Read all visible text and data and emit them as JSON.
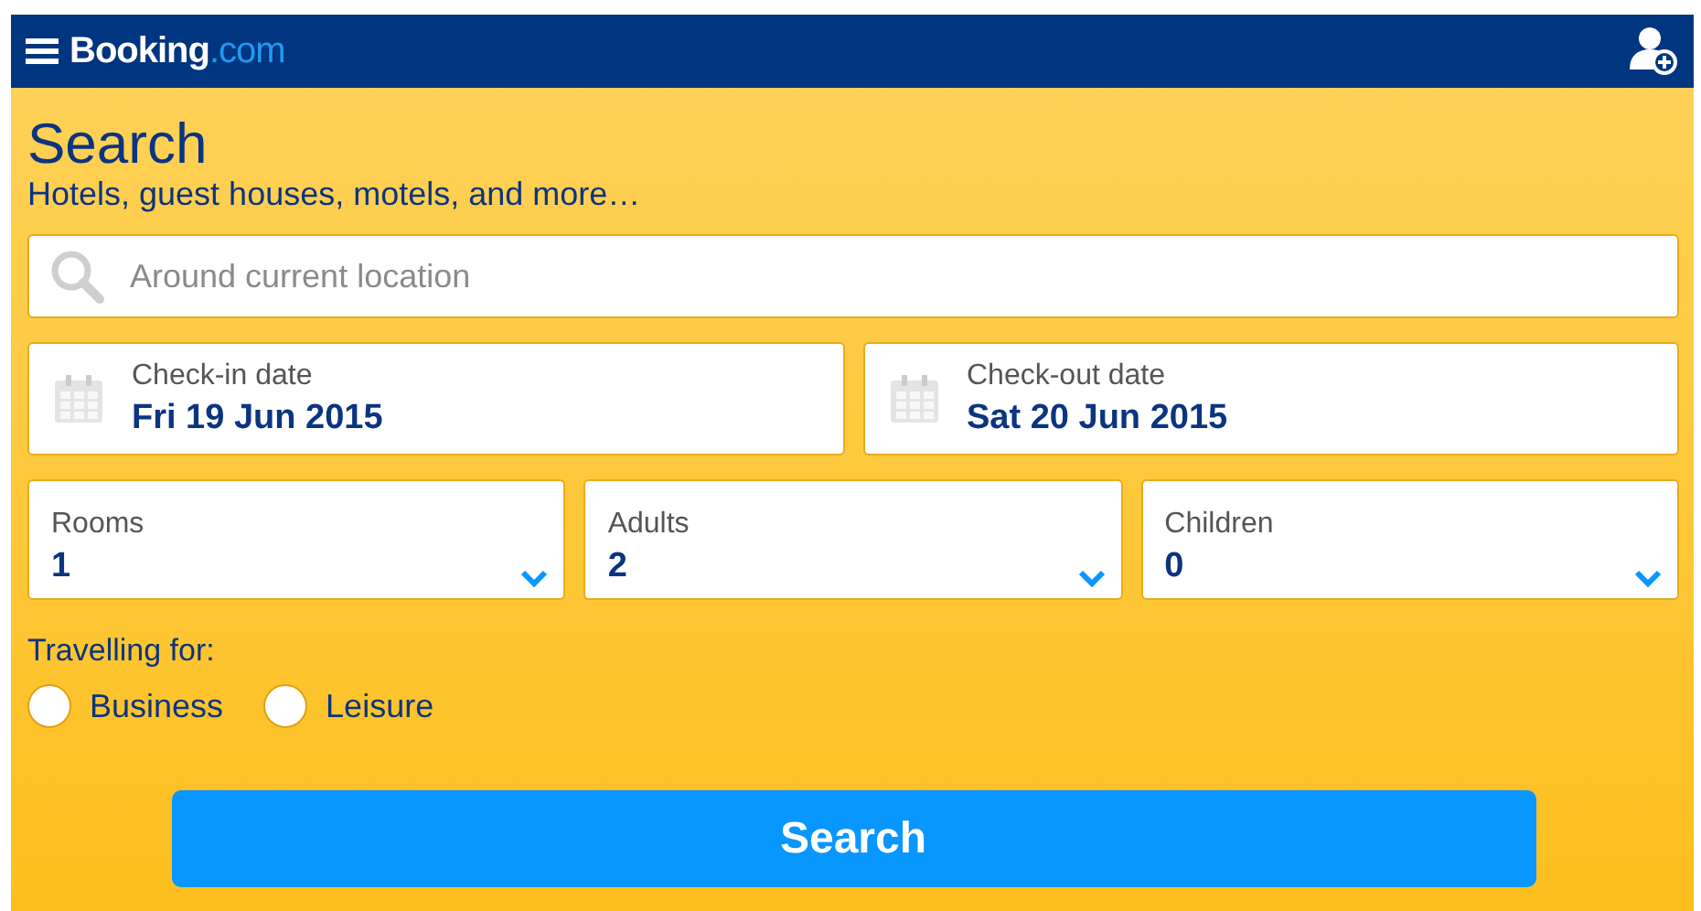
{
  "header": {
    "logo": {
      "name": "Booking",
      "suffix": ".com"
    }
  },
  "title": "Search",
  "subtitle": "Hotels, guest houses, motels, and more…",
  "search": {
    "placeholder": "Around current location"
  },
  "dates": [
    {
      "label": "Check-in date",
      "value": "Fri 19 Jun 2015"
    },
    {
      "label": "Check-out date",
      "value": "Sat 20 Jun 2015"
    }
  ],
  "selects": [
    {
      "label": "Rooms",
      "value": "1"
    },
    {
      "label": "Adults",
      "value": "2"
    },
    {
      "label": "Children",
      "value": "0"
    }
  ],
  "travelling": {
    "label": "Travelling for:",
    "options": [
      {
        "label": "Business",
        "selected": false
      },
      {
        "label": "Leisure",
        "selected": false
      }
    ]
  },
  "button": "Search"
}
